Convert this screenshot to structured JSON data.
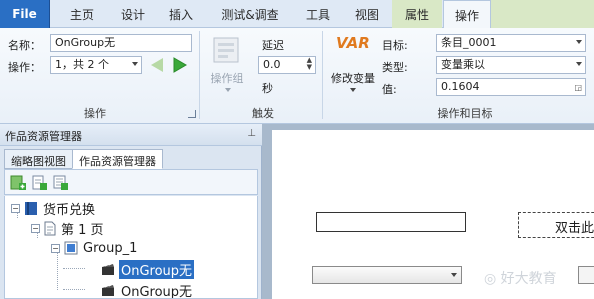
{
  "tabs": {
    "file": "File",
    "home": "主页",
    "design": "设计",
    "insert": "插入",
    "test": "测试&调查",
    "tools": "工具",
    "view": "视图",
    "properties": "属性",
    "actions": "操作"
  },
  "ribbon": {
    "name_label": "名称：",
    "name_value": "OnGroup无",
    "action_label": "操作：",
    "action_value": "1，共 2 个",
    "action_group_label": "操作",
    "action_group_btn": "操作组",
    "delay_label": "延迟",
    "delay_value": "0.0",
    "delay_unit": "秒",
    "trigger_group_label": "触发",
    "var_badge": "VAR",
    "modify_var_label": "修改变量",
    "target_label": "目标:",
    "target_value": "条目_0001",
    "type_label": "类型:",
    "type_value": "变量乘以",
    "value_label": "值:",
    "value_value": "0.1604",
    "action_target_group_label": "操作和目标"
  },
  "panel": {
    "title": "作品资源管理器",
    "pin": "⊥",
    "tab_thumbnail": "缩略图视图",
    "tab_explorer": "作品资源管理器"
  },
  "tree": {
    "root": "货币兑换",
    "page": "第 1 页",
    "group": "Group_1",
    "action1": "OnGroup无",
    "action2": "OnGroup无"
  },
  "canvas": {
    "button_text": "双击此",
    "watermark": "好大教育"
  },
  "colors": {
    "file_tab": "#2a6fc4",
    "context_tab": "#d9e8c6",
    "selection": "#2a6fc4",
    "var_icon": "#e07a1f",
    "play_green": "#3aa83a"
  }
}
